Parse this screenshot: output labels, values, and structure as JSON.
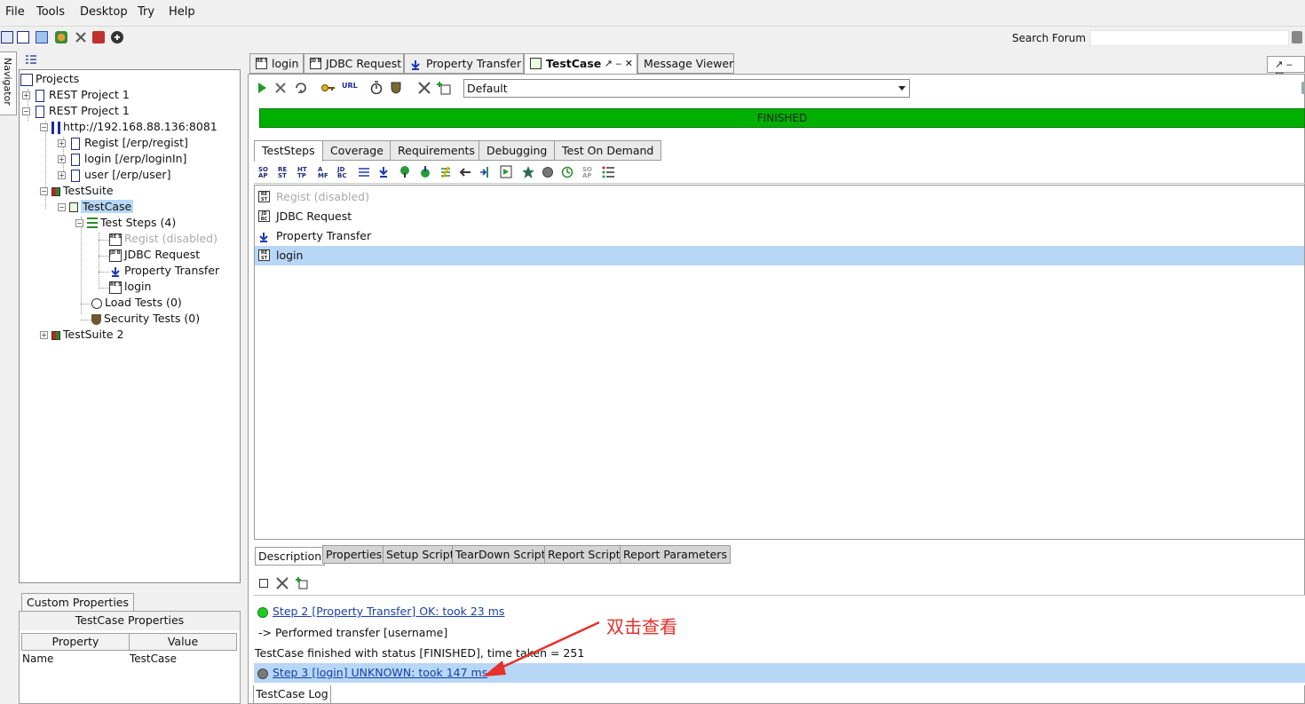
{
  "menu": {
    "file": "File",
    "tools": "Tools",
    "desktop": "Desktop",
    "try": "Try",
    "help": "Help"
  },
  "search": {
    "label": "Search Forum",
    "value": ""
  },
  "navigator": {
    "tab_label": "Navigator"
  },
  "tree": {
    "root": "Projects",
    "project1": "REST Project 1",
    "project2": "REST Project 1",
    "endpoint": "http://192.168.88.136:8081",
    "res_regist": "Regist [/erp/regist]",
    "res_login": "login [/erp/loginIn]",
    "res_user": "user [/erp/user]",
    "suite": "TestSuite",
    "testcase": "TestCase",
    "steps": "Test Steps (4)",
    "step_regist": "Regist (disabled)",
    "step_jdbc": "JDBC Request",
    "step_transfer": "Property Transfer",
    "step_login": "login",
    "load_tests": "Load Tests (0)",
    "security_tests": "Security Tests (0)",
    "suite2": "TestSuite 2"
  },
  "custom_properties": {
    "tab": "Custom Properties",
    "title": "TestCase Properties",
    "col_property": "Property",
    "col_value": "Value",
    "rows": [
      {
        "property": "Name",
        "value": "TestCase"
      }
    ]
  },
  "editor_tabs": [
    "login",
    "JDBC Request",
    "Property Transfer",
    "TestCase",
    "Message Viewer"
  ],
  "environment": {
    "selected": "Default"
  },
  "progress": {
    "status": "FINISHED",
    "fraction": 1.0,
    "color": "#00b000"
  },
  "inner_tabs": [
    "TestSteps",
    "Coverage",
    "Requirements",
    "Debugging",
    "Test On Demand"
  ],
  "steps": [
    {
      "label": "Regist (disabled)",
      "disabled": true
    },
    {
      "label": "JDBC Request",
      "disabled": false
    },
    {
      "label": "Property Transfer",
      "disabled": false
    },
    {
      "label": "login",
      "disabled": false,
      "selected": true
    }
  ],
  "bottom_tabs": [
    "Description",
    "Properties",
    "Setup Script",
    "TearDown Script",
    "Report Script",
    "Report Parameters"
  ],
  "log": {
    "step2": "Step 2 [Property Transfer] OK: took 23 ms",
    "transfer": "-> Performed transfer [username]",
    "finished": "TestCase finished with status [FINISHED], time taken = 251",
    "step3": "Step 3 [login] UNKNOWN: took 147 ms",
    "tab": "TestCase Log"
  },
  "annotation": {
    "text": "双击查看",
    "color": "#e6302a"
  }
}
